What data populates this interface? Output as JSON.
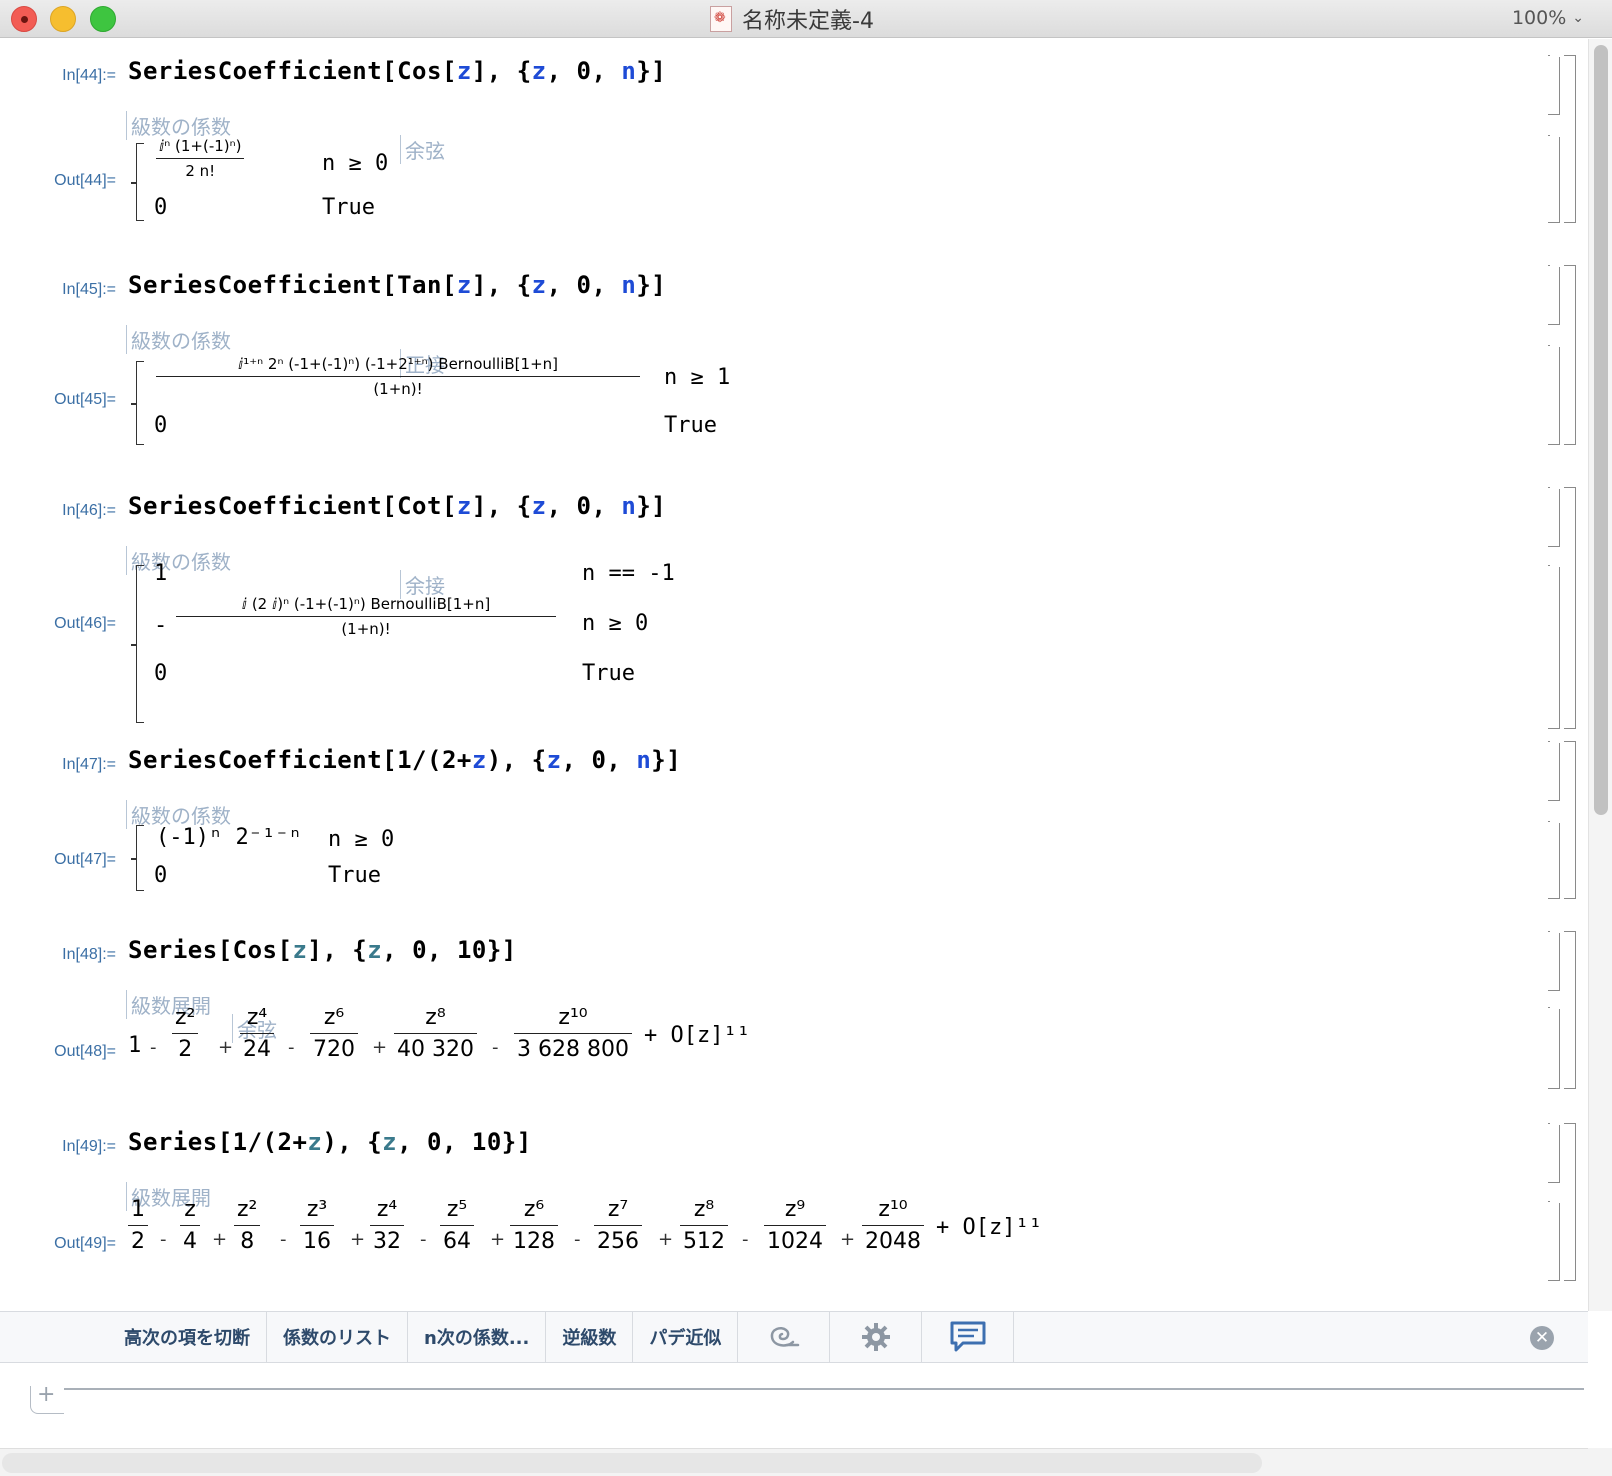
{
  "window": {
    "title": "名称未定義-4",
    "zoom": "100%"
  },
  "cells": {
    "c44": {
      "in_label": "In[44]:=",
      "out_label": "Out[44]=",
      "fn": "SeriesCoefficient",
      "arg_fn": "Cos",
      "z": "z",
      "zero": "0",
      "n": "n",
      "hint1": "級数の係数",
      "hint2": "余弦",
      "num": "ⅈⁿ (1+(-1)ⁿ)",
      "den": "2 n!",
      "cond1": "n ≥ 0",
      "val2": "0",
      "cond2": "True"
    },
    "c45": {
      "in_label": "In[45]:=",
      "out_label": "Out[45]=",
      "fn": "SeriesCoefficient",
      "arg_fn": "Tan",
      "z": "z",
      "zero": "0",
      "n": "n",
      "hint1": "級数の係数",
      "hint2": "正接",
      "num": "ⅈ¹⁺ⁿ 2ⁿ (-1+(-1)ⁿ) (-1+2¹⁺ⁿ) BernoulliB[1+n]",
      "den": "(1+n)!",
      "cond1": "n ≥ 1",
      "val2": "0",
      "cond2": "True"
    },
    "c46": {
      "in_label": "In[46]:=",
      "out_label": "Out[46]=",
      "fn": "SeriesCoefficient",
      "arg_fn": "Cot",
      "z": "z",
      "zero": "0",
      "n": "n",
      "hint1": "級数の係数",
      "hint2": "余接",
      "val1": "1",
      "cond1": "n == -1",
      "minus": "-",
      "num": "ⅈ (2 ⅈ)ⁿ (-1+(-1)ⁿ) BernoulliB[1+n]",
      "den": "(1+n)!",
      "cond2": "n ≥ 0",
      "val3": "0",
      "cond3": "True"
    },
    "c47": {
      "in_label": "In[47]:=",
      "out_label": "Out[47]=",
      "fn": "SeriesCoefficient",
      "arg": "1/(2+",
      "z": "z",
      "zero": "0",
      "n": "n",
      "hint1": "級数の係数",
      "val1": "(-1)ⁿ 2⁻¹⁻ⁿ",
      "cond1": "n ≥ 0",
      "val2": "0",
      "cond2": "True"
    },
    "c48": {
      "in_label": "In[48]:=",
      "out_label": "Out[48]=",
      "fn": "Series",
      "arg_fn": "Cos",
      "z": "z",
      "zero": "0",
      "order": "10",
      "hint1": "級数展開",
      "hint2": "余弦",
      "terms": [
        {
          "sign": "",
          "num": "1",
          "den": ""
        },
        {
          "sign": "-",
          "num": "z²",
          "den": "2"
        },
        {
          "sign": "+",
          "num": "z⁴",
          "den": "24"
        },
        {
          "sign": "-",
          "num": "z⁶",
          "den": "720"
        },
        {
          "sign": "+",
          "num": "z⁸",
          "den": "40 320"
        },
        {
          "sign": "-",
          "num": "z¹⁰",
          "den": "3 628 800"
        }
      ],
      "tail": "+ O[z]¹¹"
    },
    "c49": {
      "in_label": "In[49]:=",
      "out_label": "Out[49]=",
      "fn": "Series",
      "arg": "1/(2+",
      "z": "z",
      "zero": "0",
      "order": "10",
      "hint1": "級数展開",
      "terms": [
        {
          "sign": "",
          "num": "1",
          "den": "2"
        },
        {
          "sign": "-",
          "num": "z",
          "den": "4"
        },
        {
          "sign": "+",
          "num": "z²",
          "den": "8"
        },
        {
          "sign": "-",
          "num": "z³",
          "den": "16"
        },
        {
          "sign": "+",
          "num": "z⁴",
          "den": "32"
        },
        {
          "sign": "-",
          "num": "z⁵",
          "den": "64"
        },
        {
          "sign": "+",
          "num": "z⁶",
          "den": "128"
        },
        {
          "sign": "-",
          "num": "z⁷",
          "den": "256"
        },
        {
          "sign": "+",
          "num": "z⁸",
          "den": "512"
        },
        {
          "sign": "-",
          "num": "z⁹",
          "den": "1024"
        },
        {
          "sign": "+",
          "num": "z¹⁰",
          "den": "2048"
        }
      ],
      "tail": "+ O[z]¹¹"
    }
  },
  "toolbar": {
    "buttons": [
      "高次の項を切断",
      "係数のリスト",
      "n次の係数...",
      "逆級数",
      "パデ近似"
    ],
    "icons": [
      "spiral-icon",
      "gear-icon",
      "chat-icon",
      "close-icon"
    ]
  },
  "colors": {
    "input_var": "#1e4bd6",
    "label": "#3b6fa5",
    "hint": "#9fb2c8"
  }
}
